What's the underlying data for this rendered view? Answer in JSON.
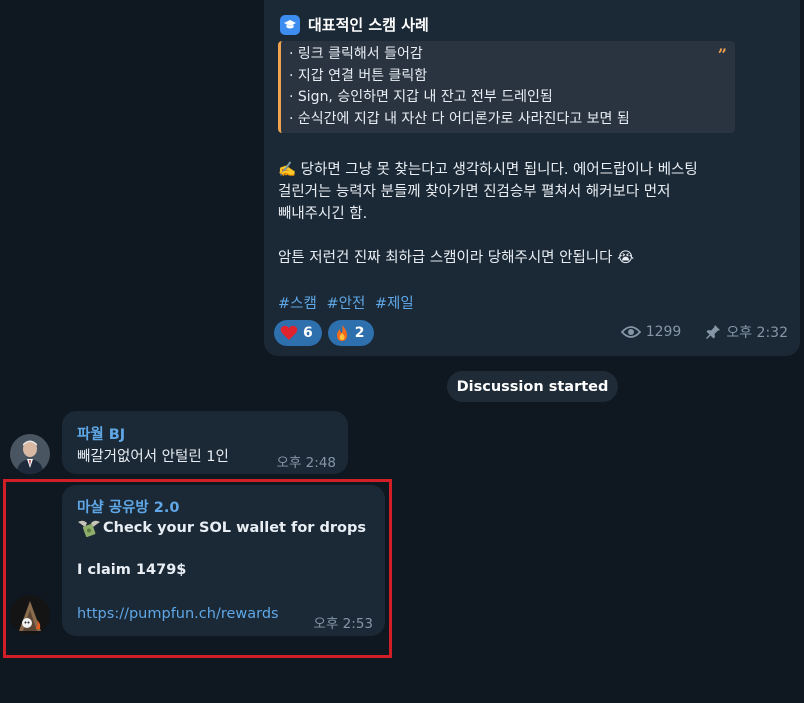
{
  "channel_post": {
    "heading": "대표적인 스캠 사례",
    "heading_icon": "graduation-cap-icon",
    "quote_lines": [
      "· 링크 클릭해서 들어감",
      "· 지갑 연결 버튼 클릭함",
      "· Sign, 승인하면 지갑 내 잔고 전부 드레인됨",
      "· 순식간에 지갑 내 자산 다 어디론가로 사라진다고 보면 됨"
    ],
    "quote_mark": "”",
    "body_line1": "✍️ 당하면 그냥 못 찾는다고 생각하시면 됩니다. 에어드랍이나 베스팅",
    "body_line2": "걸린거는 능력자 분들께 찾아가면 진검승부 펼쳐서 해커보다 먼저",
    "body_line3": "빼내주시긴 함.",
    "body_line4": "암튼 저런건 진짜 최하급 스캠이라 당해주시면 안됩니다 😭",
    "hashtags": [
      "#스캠",
      "#안전",
      "#제일"
    ],
    "reactions": [
      {
        "icon": "heart-icon",
        "count": "6"
      },
      {
        "icon": "fire-icon",
        "count": "2"
      }
    ],
    "views": "1299",
    "time": "오후 2:32"
  },
  "service_message": "Discussion started",
  "messages": [
    {
      "sender": "파월 BJ",
      "text": "빼갈거없어서 안털린 1인",
      "time": "오후 2:48"
    },
    {
      "sender": "마샬 공유방 2.0",
      "line1": "Check your SOL wallet for drops",
      "line1_icon": "money-wings-icon",
      "line2": "I claim 1479$",
      "link": "https://pumpfun.ch/rewards",
      "time": "오후 2:53"
    }
  ],
  "colors": {
    "background": "#0f1720",
    "bubble": "#1b2835",
    "accent_link": "#5fa7e6",
    "quote_border": "#f0a24e",
    "highlight_box": "#d21e26",
    "reaction_pill": "#2e6fae"
  }
}
